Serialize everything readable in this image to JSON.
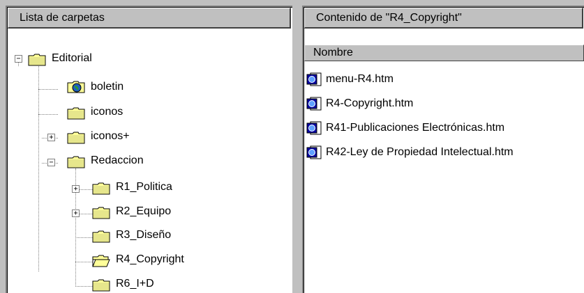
{
  "left_pane": {
    "header": "Lista de carpetas",
    "tree": [
      {
        "label": "Editorial",
        "icon": "folder-icon",
        "expander": "minus"
      },
      {
        "label": "boletin",
        "icon": "globe-folder-icon",
        "expander": "none"
      },
      {
        "label": "iconos",
        "icon": "folder-icon",
        "expander": "none"
      },
      {
        "label": "iconos+",
        "icon": "folder-icon",
        "expander": "plus"
      },
      {
        "label": "Redaccion",
        "icon": "folder-icon",
        "expander": "minus"
      },
      {
        "label": "R1_Politica",
        "icon": "folder-icon",
        "expander": "plus"
      },
      {
        "label": "R2_Equipo",
        "icon": "folder-icon",
        "expander": "plus"
      },
      {
        "label": "R3_Diseño",
        "icon": "folder-icon",
        "expander": "none"
      },
      {
        "label": "R4_Copyright",
        "icon": "open-folder-icon",
        "expander": "none"
      },
      {
        "label": "R6_I+D",
        "icon": "folder-icon",
        "expander": "none"
      }
    ]
  },
  "right_pane": {
    "header": "Contenido de \"R4_Copyright\"",
    "column_header": "Nombre",
    "files": [
      {
        "label": "menu-R4.htm",
        "icon": "html-file-icon"
      },
      {
        "label": "R4-Copyright.htm",
        "icon": "html-file-icon"
      },
      {
        "label": "R41-Publicaciones Electrónicas.htm",
        "icon": "html-file-icon"
      },
      {
        "label": "R42-Ley de Propiedad Intelectual.htm",
        "icon": "html-file-icon"
      }
    ]
  },
  "colors": {
    "folder_yellow": "#ffff99",
    "folder_edge": "#808000",
    "face": "#c0c0c0"
  }
}
